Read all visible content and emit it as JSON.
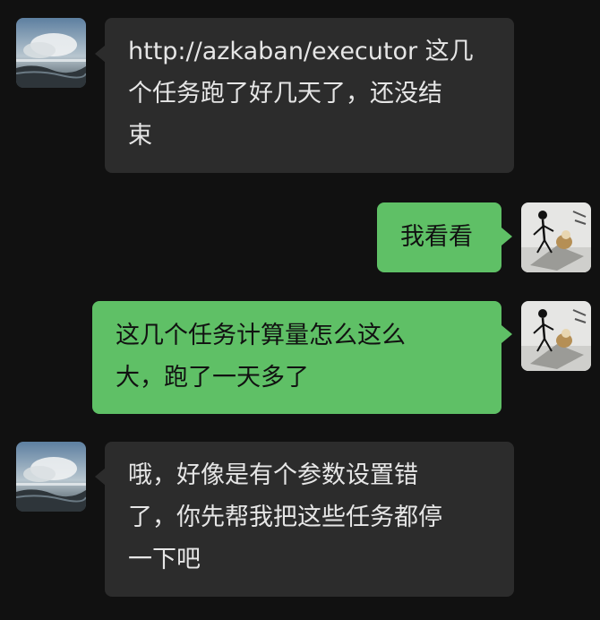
{
  "messages": [
    {
      "side": "in",
      "text": "http://azkaban/executor 这几\n个任务跑了好几天了，还没结\n束",
      "avatar": "beach-sky-avatar"
    },
    {
      "side": "out",
      "text": "我看看",
      "avatar": "stick-figure-avatar"
    },
    {
      "side": "out",
      "text": "这几个任务计算量怎么这么\n大，跑了一天多了",
      "avatar": "stick-figure-avatar"
    },
    {
      "side": "in",
      "text": "哦，好像是有个参数设置错\n了，你先帮我把这些任务都停\n一下吧",
      "avatar": "beach-sky-avatar"
    }
  ],
  "colors": {
    "background": "#111111",
    "incoming_bubble": "#2c2c2c",
    "outgoing_bubble": "#5fc066",
    "incoming_text": "#e6e6e6",
    "outgoing_text": "#111111"
  }
}
